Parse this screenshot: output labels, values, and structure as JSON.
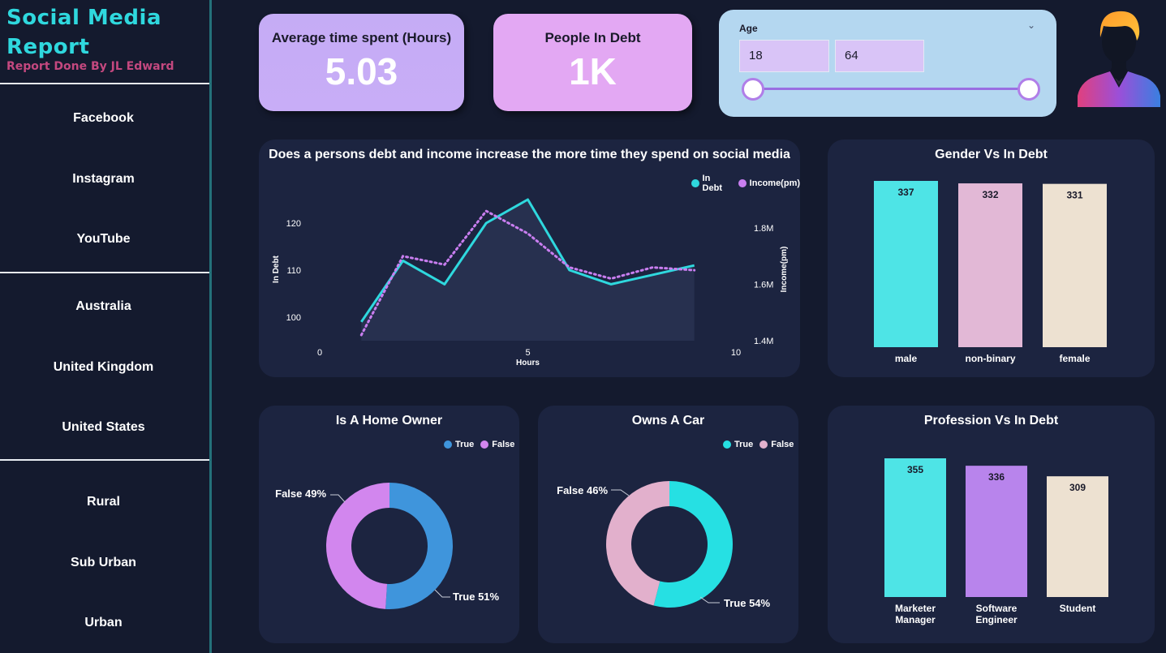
{
  "brand": {
    "title": "Social Media Report",
    "subtitle": "Report Done By JL Edward"
  },
  "nav": {
    "platforms": [
      "Facebook",
      "Instagram",
      "YouTube"
    ],
    "countries": [
      "Australia",
      "United Kingdom",
      "United States"
    ],
    "areas": [
      "Rural",
      "Sub Urban",
      "Urban"
    ]
  },
  "kpis": {
    "avg_time_label": "Average time spent (Hours)",
    "avg_time_value": "5.03",
    "debt_label": "People In Debt",
    "debt_value": "1K"
  },
  "age_slicer": {
    "label": "Age",
    "min": "18",
    "max": "64"
  },
  "colors": {
    "background": "#141a2e",
    "card": "#1c2440",
    "cyan": "#2fd8de",
    "purple": "#c97ef0",
    "pink": "#e2b8d6",
    "cream": "#ede1d1",
    "violet": "#b07ee8",
    "blue": "#3f95dc"
  },
  "chart_data": [
    {
      "type": "line",
      "title": "Does a persons debt and income increase the more time they spend on social media",
      "xlabel": "Hours",
      "ylabel": "In Debt",
      "y2label": "Income(pm)",
      "xlim": [
        0,
        10
      ],
      "x_ticks": [
        "0",
        "5",
        "10"
      ],
      "y_ticks": [
        "100",
        "110",
        "120"
      ],
      "y2_ticks": [
        "1.4M",
        "1.6M",
        "1.8M"
      ],
      "x": [
        1,
        2,
        3,
        4,
        5,
        6,
        7,
        8,
        9
      ],
      "series": [
        {
          "name": "In Debt",
          "values": [
            99,
            112,
            107,
            120,
            125,
            110,
            107,
            109,
            111
          ]
        },
        {
          "name": "Income(pm)",
          "values": [
            1.42,
            1.7,
            1.67,
            1.86,
            1.78,
            1.66,
            1.62,
            1.66,
            1.65
          ]
        }
      ],
      "legend": [
        "In Debt",
        "Income(pm)"
      ]
    },
    {
      "type": "bar",
      "title": "Gender Vs In Debt",
      "categories": [
        "male",
        "non-binary",
        "female"
      ],
      "values": [
        337,
        332,
        331
      ]
    },
    {
      "type": "pie",
      "title": "Is A Home Owner",
      "labels": [
        "True",
        "False"
      ],
      "values": [
        51,
        49
      ],
      "slice_labels": [
        "True 51%",
        "False 49%"
      ],
      "legend": [
        "True",
        "False"
      ]
    },
    {
      "type": "pie",
      "title": "Owns A Car",
      "labels": [
        "True",
        "False"
      ],
      "values": [
        54,
        46
      ],
      "slice_labels": [
        "True 54%",
        "False 46%"
      ],
      "legend": [
        "True",
        "False"
      ]
    },
    {
      "type": "bar",
      "title": "Profession Vs In Debt",
      "categories": [
        "Marketer Manager",
        "Software Engineer",
        "Student"
      ],
      "values": [
        355,
        336,
        309
      ]
    }
  ]
}
